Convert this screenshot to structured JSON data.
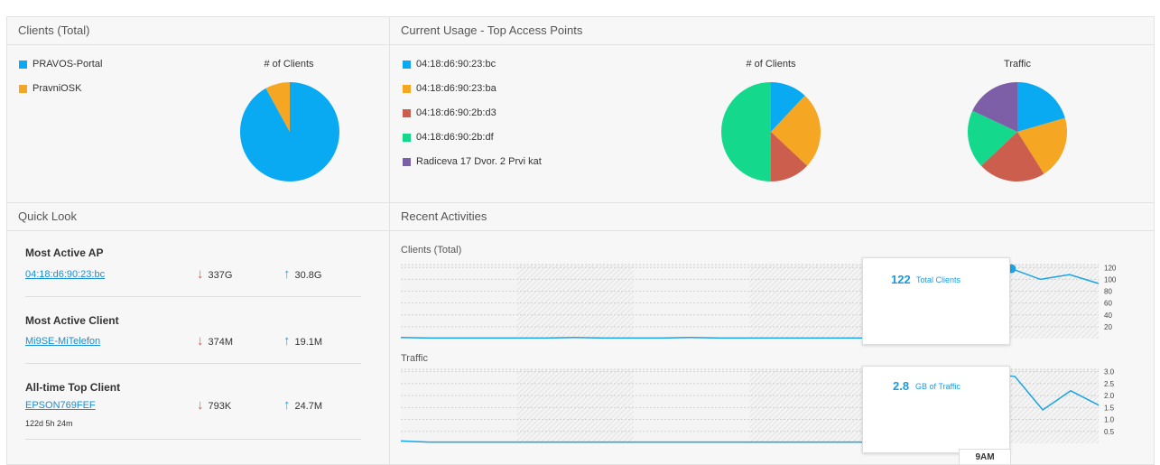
{
  "clients_total": {
    "title": "Clients (Total)",
    "legend": [
      {
        "label": "PRAVOS-Portal",
        "color": "#0aaaf2"
      },
      {
        "label": "PravniOSK",
        "color": "#f5a623"
      }
    ],
    "chart_title": "# of Clients"
  },
  "top_access_points": {
    "title": "Current Usage - Top Access Points",
    "legend": [
      {
        "label": "04:18:d6:90:23:bc",
        "color": "#0aaaf2"
      },
      {
        "label": "04:18:d6:90:23:ba",
        "color": "#f5a623"
      },
      {
        "label": "04:18:d6:90:2b:d3",
        "color": "#cc5e4e"
      },
      {
        "label": "04:18:d6:90:2b:df",
        "color": "#14d98c"
      },
      {
        "label": "Radiceva 17 Dvor. 2 Prvi kat",
        "color": "#7d5fa8"
      }
    ],
    "clients_chart_title": "# of Clients",
    "traffic_chart_title": "Traffic"
  },
  "quick_look": {
    "title": "Quick Look",
    "items": [
      {
        "heading": "Most Active AP",
        "name": "04:18:d6:90:23:bc",
        "down": "337G",
        "up": "30.8G",
        "sub": ""
      },
      {
        "heading": "Most Active Client",
        "name": "Mi9SE-MiTelefon",
        "down": "374M",
        "up": "19.1M",
        "sub": ""
      },
      {
        "heading": "All-time Top Client",
        "name": "EPSON769FEF",
        "down": "793K",
        "up": "24.7M",
        "sub": "122d 5h 24m"
      }
    ]
  },
  "recent_activities": {
    "title": "Recent Activities",
    "clients_label": "Clients (Total)",
    "traffic_label": "Traffic",
    "clients_tooltip_value": "122",
    "clients_tooltip_text": "Total Clients",
    "traffic_tooltip_value": "2.8",
    "traffic_tooltip_text": "GB of Traffic",
    "time_label": "9AM"
  },
  "chart_data": [
    {
      "type": "pie",
      "title": "# of Clients",
      "categories": [
        "PRAVOS-Portal",
        "PravniOSK"
      ],
      "values": [
        92,
        8
      ],
      "colors": [
        "#0aaaf2",
        "#f5a623"
      ]
    },
    {
      "type": "pie",
      "title": "# of Clients",
      "categories": [
        "04:18:d6:90:23:bc",
        "04:18:d6:90:23:ba",
        "04:18:d6:90:2b:d3",
        "04:18:d6:90:2b:df"
      ],
      "values": [
        12,
        25,
        13,
        50
      ],
      "colors": [
        "#0aaaf2",
        "#f5a623",
        "#cc5e4e",
        "#14d98c"
      ]
    },
    {
      "type": "pie",
      "title": "Traffic",
      "categories": [
        "04:18:d6:90:23:bc",
        "04:18:d6:90:23:ba",
        "04:18:d6:90:2b:d3",
        "04:18:d6:90:2b:df",
        "Radiceva 17 Dvor. 2 Prvi kat"
      ],
      "values": [
        20.5,
        20.5,
        22,
        19,
        18
      ],
      "colors": [
        "#0aaaf2",
        "#f5a623",
        "#cc5e4e",
        "#14d98c",
        "#7d5fa8"
      ]
    },
    {
      "type": "line",
      "title": "Clients (Total)",
      "x": [
        0,
        1,
        2,
        3,
        4,
        5,
        6,
        7,
        8,
        9,
        10,
        11,
        12,
        13,
        14,
        15,
        16,
        17,
        18,
        19,
        20,
        21,
        22,
        23
      ],
      "values": [
        2,
        1,
        1,
        1,
        1,
        1,
        2,
        1,
        1,
        1,
        2,
        1,
        1,
        1,
        1,
        1,
        1,
        1,
        1,
        1,
        25,
        118,
        100,
        108,
        93
      ],
      "ylim": [
        0,
        125
      ],
      "yticks": [
        20,
        40,
        60,
        80,
        100,
        120
      ]
    },
    {
      "type": "line",
      "title": "Traffic",
      "x": [
        0,
        1,
        2,
        3,
        4,
        5,
        6,
        7,
        8,
        9,
        10,
        11,
        12,
        13,
        14,
        15,
        16,
        17,
        18,
        19,
        20,
        21,
        22,
        23
      ],
      "values": [
        0.1,
        0.05,
        0.05,
        0.05,
        0.05,
        0.05,
        0.05,
        0.05,
        0.05,
        0.05,
        0.05,
        0.05,
        0.05,
        0.05,
        0.05,
        0.05,
        0.05,
        0.05,
        0.05,
        0.05,
        0.1,
        2.9,
        2.8,
        1.4,
        2.2,
        1.6
      ],
      "ylim": [
        0,
        3.1
      ],
      "yticks": [
        0.5,
        1.0,
        1.5,
        2.0,
        2.5,
        3.0
      ]
    }
  ]
}
